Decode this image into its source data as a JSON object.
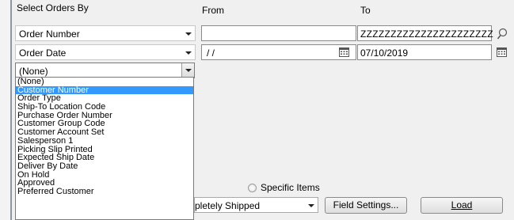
{
  "labels": {
    "select_orders_by": "Select Orders By",
    "from": "From",
    "to": "To",
    "specific_items": "Specific Items"
  },
  "criteria": [
    {
      "field": "Order Number",
      "from": "",
      "to": "ZZZZZZZZZZZZZZZZZZZZZZ"
    },
    {
      "field": "Order Date",
      "from": "/ /",
      "to": "07/10/2019"
    },
    {
      "field": "(None)"
    }
  ],
  "dropdown_options": [
    "(None)",
    "Customer Number",
    "Order Type",
    "Ship-To Location Code",
    "Purchase Order Number",
    "Customer Group Code",
    "Customer Account Set",
    "Salesperson 1",
    "Picking Slip Printed",
    "Expected Ship Date",
    "Deliver By Date",
    "On Hold",
    "Approved",
    "Preferred Customer"
  ],
  "dropdown_selected": "Customer Number",
  "bottom": {
    "status_value": "pletely Shipped",
    "field_settings_label": "Field Settings...",
    "load_label": "Load"
  },
  "colors": {
    "selection": "#3399ff",
    "panel": "#f0f0f0"
  }
}
